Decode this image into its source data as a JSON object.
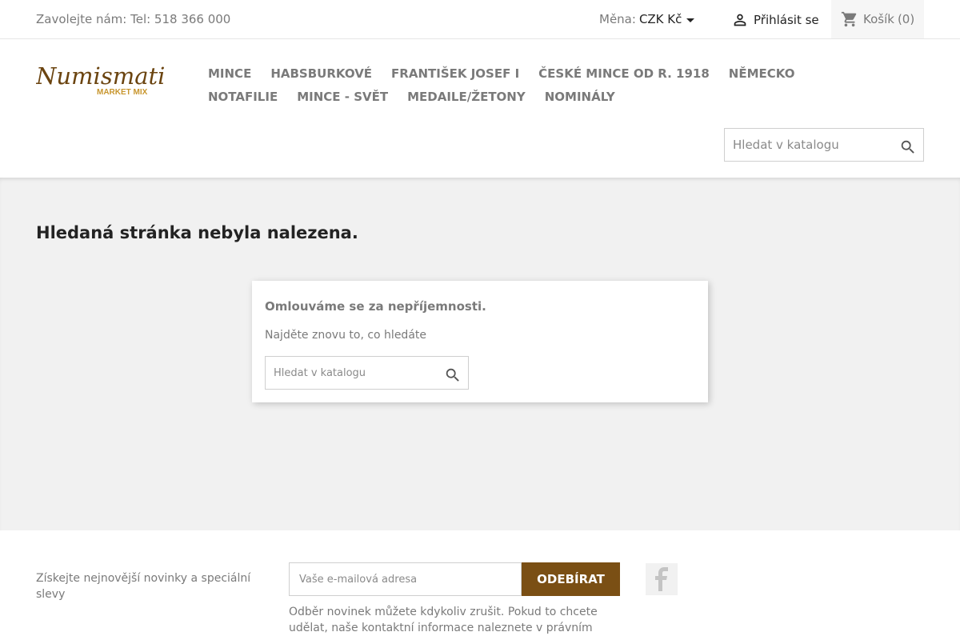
{
  "topbar": {
    "contact": "Zavolejte nám: Tel: 518 366 000",
    "currency_label": "Měna:",
    "currency_value": "CZK Kč",
    "login": "Přihlásit se",
    "cart_label": "Košík",
    "cart_count": "(0)"
  },
  "header": {
    "logo_text": "Numismatika",
    "logo_subtext": "MARKET MIX",
    "nav": [
      "MINCE",
      "HABSBURKOVÉ",
      "FRANTIŠEK JOSEF I",
      "ČESKÉ MINCE OD R. 1918",
      "NĚMECKO",
      "NOTAFILIE",
      "MINCE - SVĚT",
      "MEDAILE/ŽETONY",
      "NOMINÁLY"
    ],
    "search_placeholder": "Hledat v katalogu"
  },
  "content": {
    "title": "Hledaná stránka nebyla nalezena.",
    "card_heading": "Omlouváme se za nepříjemnosti.",
    "card_text": "Najděte znovu to, co hledáte",
    "search_placeholder": "Hledat v katalogu"
  },
  "footer": {
    "newsletter_text": "Získejte nejnovější novinky a speciální slevy",
    "email_placeholder": "Vaše e-mailová adresa",
    "subscribe_label": "ODEBÍRAT",
    "note": "Odběr novinek můžete kdykoliv zrušit. Pokud to chcete udělat, naše kontaktní informace naleznete v právním"
  },
  "colors": {
    "accent": "#7a4f14",
    "logo_gold": "#c8962e",
    "logo_brown": "#6b4410",
    "content_bg": "#f1f1f1"
  },
  "icons": {
    "login": "person-icon",
    "cart": "shopping-cart-icon",
    "search": "search-icon",
    "social": "facebook-icon",
    "currency": "caret-down-icon"
  }
}
